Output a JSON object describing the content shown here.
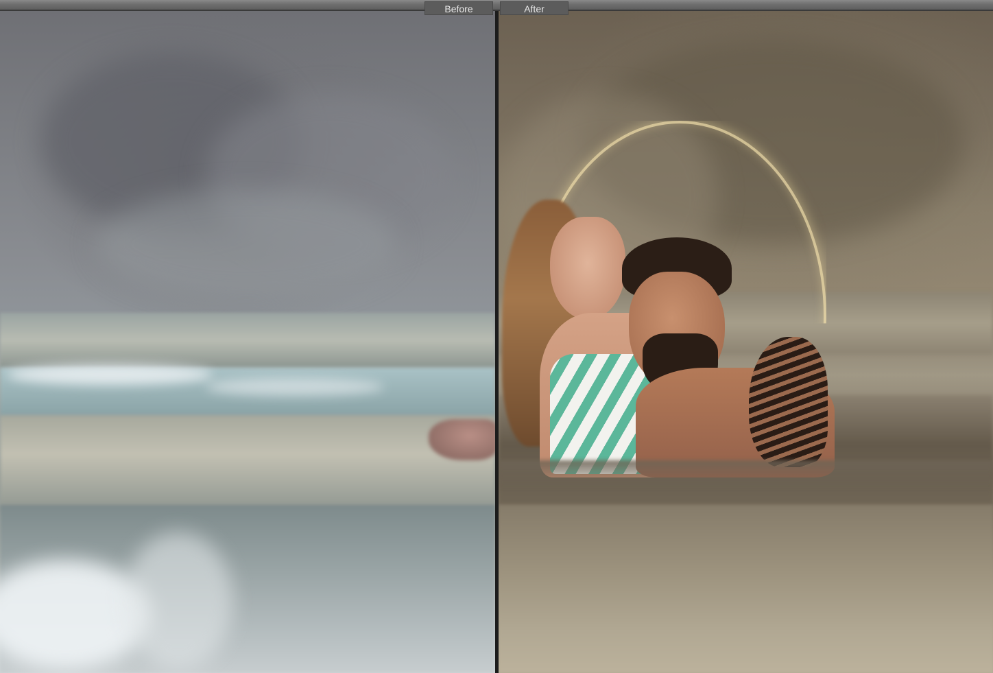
{
  "viewer": {
    "before_label": "Before",
    "after_label": "After"
  },
  "colors": {
    "topbar": "#6e6e6e",
    "label_bg": "#5c5c5c",
    "label_text": "#e8e8e8",
    "divider": "#1c1c1c"
  }
}
